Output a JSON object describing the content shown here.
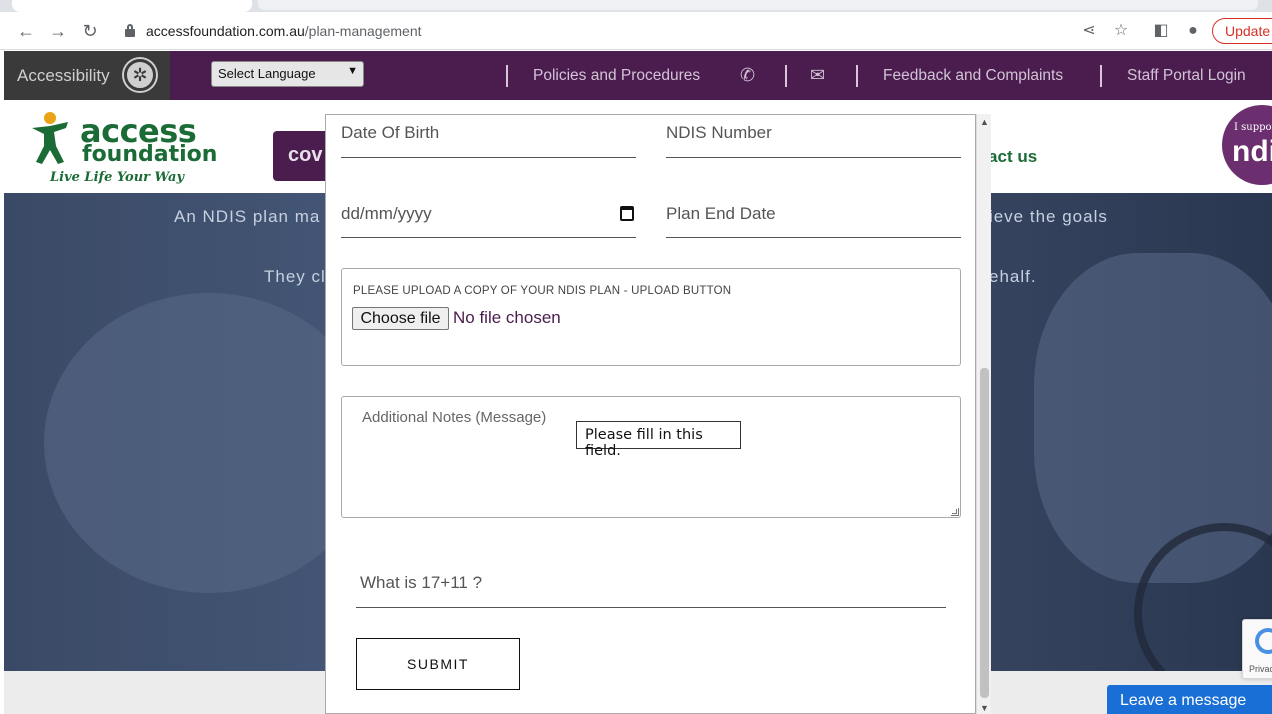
{
  "browser": {
    "url_domain": "accessfoundation.com.au",
    "url_path": "/plan-management",
    "update_label": "Update",
    "back_icon": "arrow-left-icon",
    "forward_icon": "arrow-right-icon",
    "reload_icon": "reload-icon"
  },
  "topbar": {
    "accessibility_label": "Accessibility",
    "language_select": "Select Language",
    "links": [
      "Policies and Procedures",
      "Feedback and Complaints",
      "Staff Portal Login"
    ]
  },
  "header": {
    "logo_access": "access",
    "logo_foundation": "foundation",
    "logo_tagline": "Live Life Your Way",
    "nav_partial_left": "cov",
    "nav_partial_right": "ntact us",
    "badge_small": "I support",
    "badge_big": "ndi"
  },
  "hero": {
    "line1_left": "An NDIS plan ma",
    "line1_right": "chieve the goals",
    "line2_left": "They cl",
    "line2_right": "ehalf."
  },
  "form": {
    "dob_label": "Date Of Birth",
    "ndis_number_label": "NDIS Number",
    "date_placeholder": "dd/mm/yyyy",
    "plan_end_label": "Plan End Date",
    "upload_label": "PLEASE UPLOAD A COPY OF YOUR NDIS PLAN - UPLOAD BUTTON",
    "choose_file": "Choose file",
    "no_file": "No file chosen",
    "notes_placeholder": "Additional Notes (Message)",
    "tooltip": "Please fill in this field.",
    "captcha_label": "What is 17+11 ?",
    "submit": "SUBMIT"
  },
  "chat": {
    "label": "Leave a message"
  },
  "recaptcha": {
    "text": "Privacy"
  },
  "colors": {
    "brand_purple": "#4a1d4e",
    "brand_green": "#1b6b36",
    "chat_blue": "#1a6fd6",
    "update_red": "#d93025"
  }
}
